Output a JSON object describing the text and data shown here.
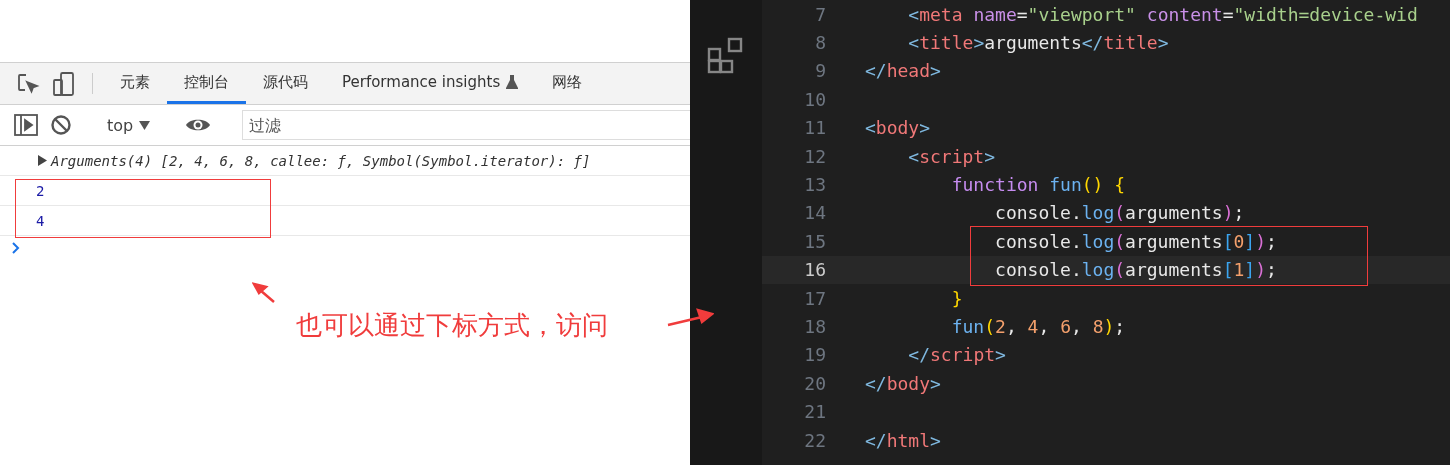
{
  "devtools": {
    "tabs": [
      {
        "label": "元素",
        "selected": false
      },
      {
        "label": "控制台",
        "selected": true
      },
      {
        "label": "源代码",
        "selected": false
      },
      {
        "label": "Performance insights",
        "selected": false,
        "experimental": true
      },
      {
        "label": "网络",
        "selected": false
      }
    ],
    "context": "top",
    "filter": {
      "placeholder": "过滤"
    },
    "console": [
      {
        "kind": "object",
        "text": "Arguments(4) [2, 4, 6, 8, callee: ƒ, Symbol(Symbol.iterator): ƒ]",
        "expanded": false
      },
      {
        "kind": "number",
        "text": "2"
      },
      {
        "kind": "number",
        "text": "4"
      }
    ]
  },
  "editor": {
    "lines": [
      {
        "number": "7",
        "current": false,
        "tokens": [
          {
            "kind": "punct",
            "text": "    <"
          },
          {
            "kind": "tag",
            "text": "meta"
          },
          {
            "kind": "attr",
            "text": " name"
          },
          {
            "kind": "plain",
            "text": "="
          },
          {
            "kind": "string",
            "text": "\"viewport\""
          },
          {
            "kind": "attr",
            "text": " content"
          },
          {
            "kind": "plain",
            "text": "="
          },
          {
            "kind": "string",
            "text": "\"width=device-wid"
          }
        ]
      },
      {
        "number": "8",
        "current": false,
        "tokens": [
          {
            "kind": "punct",
            "text": "    <"
          },
          {
            "kind": "tag",
            "text": "title"
          },
          {
            "kind": "punct",
            "text": ">"
          },
          {
            "kind": "plain",
            "text": "arguments"
          },
          {
            "kind": "punct",
            "text": "</"
          },
          {
            "kind": "tag",
            "text": "title"
          },
          {
            "kind": "punct",
            "text": ">"
          }
        ]
      },
      {
        "number": "9",
        "current": false,
        "tokens": [
          {
            "kind": "punct",
            "text": "</"
          },
          {
            "kind": "tag",
            "text": "head"
          },
          {
            "kind": "punct",
            "text": ">"
          }
        ]
      },
      {
        "number": "10",
        "current": false
      },
      {
        "number": "11",
        "current": false,
        "tokens": [
          {
            "kind": "punct",
            "text": "<"
          },
          {
            "kind": "tag",
            "text": "body"
          },
          {
            "kind": "punct",
            "text": ">"
          }
        ]
      },
      {
        "number": "12",
        "current": false,
        "tokens": [
          {
            "kind": "punct",
            "text": "    <"
          },
          {
            "kind": "tag",
            "text": "script"
          },
          {
            "kind": "punct",
            "text": ">"
          }
        ]
      },
      {
        "number": "13",
        "current": false,
        "tokens": [
          {
            "kind": "keyword",
            "text": "        function"
          },
          {
            "kind": "func",
            "text": " fun"
          },
          {
            "kind": "bracket",
            "text": "() {"
          }
        ]
      },
      {
        "number": "14",
        "current": false,
        "tokens": [
          {
            "kind": "plain",
            "text": "            console."
          },
          {
            "kind": "func",
            "text": "log"
          },
          {
            "kind": "bracket2",
            "text": "("
          },
          {
            "kind": "plain",
            "text": "arguments"
          },
          {
            "kind": "bracket2",
            "text": ")"
          },
          {
            "kind": "plain",
            "text": ";"
          }
        ]
      },
      {
        "number": "15",
        "current": false,
        "tokens": [
          {
            "kind": "plain",
            "text": "            console."
          },
          {
            "kind": "func",
            "text": "log"
          },
          {
            "kind": "bracket2",
            "text": "("
          },
          {
            "kind": "plain",
            "text": "arguments"
          },
          {
            "kind": "bracket3",
            "text": "["
          },
          {
            "kind": "number",
            "text": "0"
          },
          {
            "kind": "bracket3",
            "text": "]"
          },
          {
            "kind": "bracket2",
            "text": ")"
          },
          {
            "kind": "plain",
            "text": ";"
          }
        ]
      },
      {
        "number": "16",
        "current": true,
        "tokens": [
          {
            "kind": "plain",
            "text": "            console."
          },
          {
            "kind": "func",
            "text": "log"
          },
          {
            "kind": "bracket2",
            "text": "("
          },
          {
            "kind": "plain",
            "text": "arguments"
          },
          {
            "kind": "bracket3",
            "text": "["
          },
          {
            "kind": "number",
            "text": "1"
          },
          {
            "kind": "bracket3",
            "text": "]"
          },
          {
            "kind": "bracket2",
            "text": ")"
          },
          {
            "kind": "plain",
            "text": ";"
          }
        ]
      },
      {
        "number": "17",
        "current": false,
        "tokens": [
          {
            "kind": "bracket",
            "text": "        }"
          }
        ]
      },
      {
        "number": "18",
        "current": false,
        "tokens": [
          {
            "kind": "func",
            "text": "        fun"
          },
          {
            "kind": "bracket",
            "text": "("
          },
          {
            "kind": "number",
            "text": "2"
          },
          {
            "kind": "plain",
            "text": ", "
          },
          {
            "kind": "number",
            "text": "4"
          },
          {
            "kind": "plain",
            "text": ", "
          },
          {
            "kind": "number",
            "text": "6"
          },
          {
            "kind": "plain",
            "text": ", "
          },
          {
            "kind": "number",
            "text": "8"
          },
          {
            "kind": "bracket",
            "text": ")"
          },
          {
            "kind": "plain",
            "text": ";"
          }
        ]
      },
      {
        "number": "19",
        "current": false,
        "tokens": [
          {
            "kind": "punct",
            "text": "    </"
          },
          {
            "kind": "tag",
            "text": "script"
          },
          {
            "kind": "punct",
            "text": ">"
          }
        ]
      },
      {
        "number": "20",
        "current": false,
        "tokens": [
          {
            "kind": "punct",
            "text": "</"
          },
          {
            "kind": "tag",
            "text": "body"
          },
          {
            "kind": "punct",
            "text": ">"
          }
        ]
      },
      {
        "number": "21",
        "current": false
      },
      {
        "number": "22",
        "current": false,
        "tokens": [
          {
            "kind": "punct",
            "text": "</"
          },
          {
            "kind": "tag",
            "text": "html"
          },
          {
            "kind": "punct",
            "text": ">"
          }
        ]
      }
    ]
  },
  "annotation": {
    "text": "也可以通过下标方式，访问",
    "color": "#f03c3c"
  }
}
